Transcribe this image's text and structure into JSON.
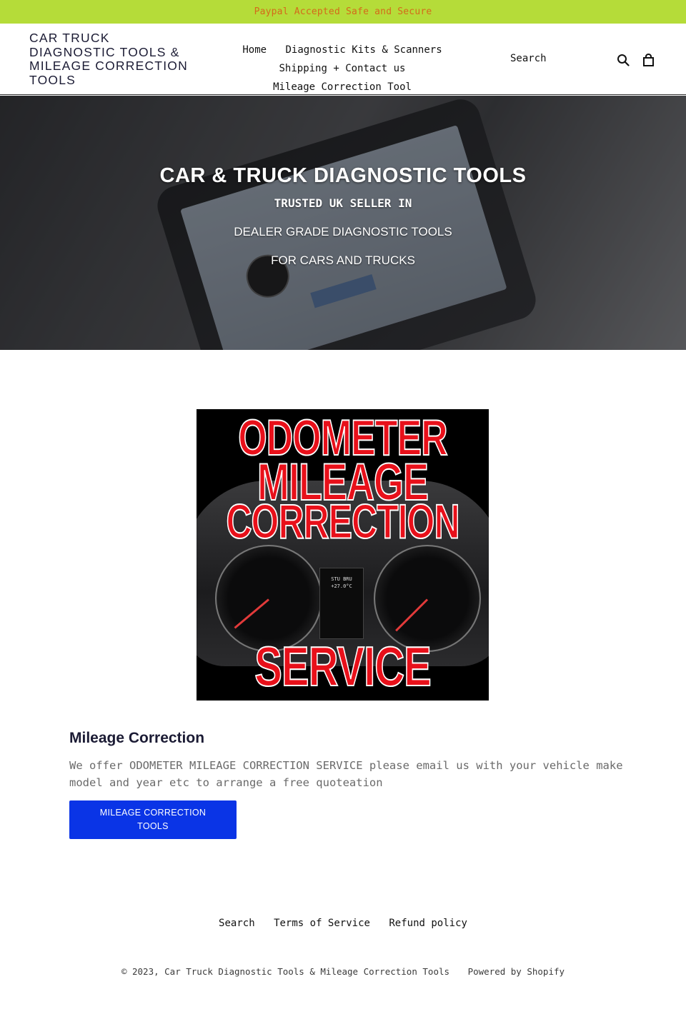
{
  "announcement": {
    "text": "Paypal Accepted Safe and Secure"
  },
  "header": {
    "logo": "CAR TRUCK DIAGNOSTIC TOOLS & MILEAGE CORRECTION TOOLS",
    "nav": [
      {
        "label": "Home"
      },
      {
        "label": "Diagnostic Kits & Scanners"
      },
      {
        "label": "Shipping + Contact us"
      },
      {
        "label": "Mileage Correction Tool"
      }
    ],
    "search_label": "Search",
    "icons": {
      "search": "search-icon",
      "cart": "cart-icon"
    }
  },
  "hero": {
    "title": "CAR & TRUCK DIAGNOSTIC TOOLS",
    "line1": "TRUSTED UK SELLER IN",
    "line2": "DEALER GRADE DIAGNOSTIC TOOLS",
    "line3": "FOR CARS AND TRUCKS"
  },
  "promo_image": {
    "lines": [
      "ODOMETER",
      "MILEAGE",
      "CORRECTION",
      "SERVICE"
    ],
    "lcd_text": [
      "STU BRU",
      "+27.0°C"
    ],
    "accent_color": "#e8101a"
  },
  "feature": {
    "title": "Mileage Correction",
    "body": "We offer ODOMETER MILEAGE CORRECTION SERVICE please email us with your vehicle make model and year etc to arrange a free quoteation",
    "button_label": "MILEAGE CORRECTION TOOLS",
    "button_color": "#0a34e6"
  },
  "footer": {
    "links": [
      {
        "label": "Search"
      },
      {
        "label": "Terms of Service"
      },
      {
        "label": "Refund policy"
      }
    ],
    "copyright": "© 2023, Car Truck Diagnostic Tools & Mileage Correction Tools",
    "powered_by": "Powered by Shopify"
  },
  "colors": {
    "announcement_bg": "#b5dc39",
    "announcement_text": "#d46a1a"
  }
}
